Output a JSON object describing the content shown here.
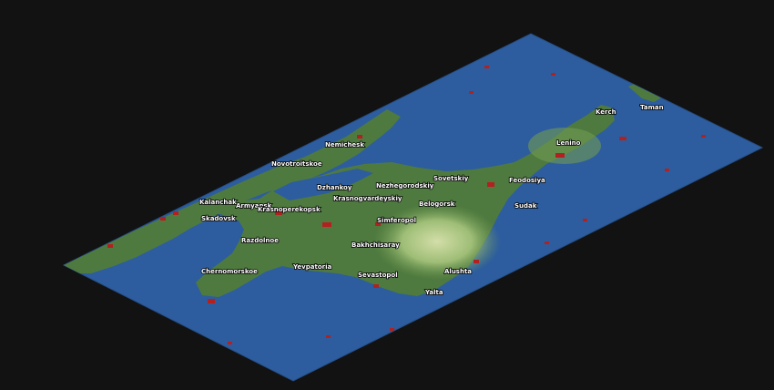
{
  "game": {
    "view": "isometric-map",
    "region_labels": [
      {
        "id": "kerch",
        "label": "Kerch"
      },
      {
        "id": "taman",
        "label": "Taman"
      },
      {
        "id": "lenino",
        "label": "Lenino"
      },
      {
        "id": "nemichesk",
        "label": "Nemichesk"
      },
      {
        "id": "novotroitskoe",
        "label": "Novotroitskoe"
      },
      {
        "id": "sovetskiy",
        "label": "Sovetskiy"
      },
      {
        "id": "feodosiya",
        "label": "Feodosiya"
      },
      {
        "id": "dzhankoy",
        "label": "Dzhankoy"
      },
      {
        "id": "nezhegorodskiy",
        "label": "Nezhegorodskiy"
      },
      {
        "id": "kalanchak",
        "label": "Kalanchak"
      },
      {
        "id": "krasnogvardeyskiy",
        "label": "Krasnogvardeyskiy"
      },
      {
        "id": "armyansk",
        "label": "Armyansk"
      },
      {
        "id": "krasnoperekopsk",
        "label": "Krasnoperekopsk"
      },
      {
        "id": "belogorsk",
        "label": "Belogorsk"
      },
      {
        "id": "sudak",
        "label": "Sudak"
      },
      {
        "id": "skadovsk",
        "label": "Skadovsk"
      },
      {
        "id": "simferopol",
        "label": "Simferopol"
      },
      {
        "id": "razdolnoe",
        "label": "Razdolnoe"
      },
      {
        "id": "bakhchisaray",
        "label": "Bakhchisaray"
      },
      {
        "id": "chernomorskoe",
        "label": "Chernomorskoe"
      },
      {
        "id": "yevpatoria",
        "label": "Yevpatoria"
      },
      {
        "id": "sevastopol",
        "label": "Sevastopol"
      },
      {
        "id": "alushta",
        "label": "Alushta"
      },
      {
        "id": "yalta",
        "label": "Yalta"
      }
    ]
  },
  "colors": {
    "background": "#121212",
    "sea": "#2d5d9e",
    "sea_edge": "#264f88",
    "land": "#4f7a3f",
    "land_light": "#6f9a52",
    "hills": "#a7c57c",
    "peaks": "#e2e9b4",
    "town": "#5a3a2a",
    "industry": "#b32020",
    "label_text": "#ffffff"
  }
}
